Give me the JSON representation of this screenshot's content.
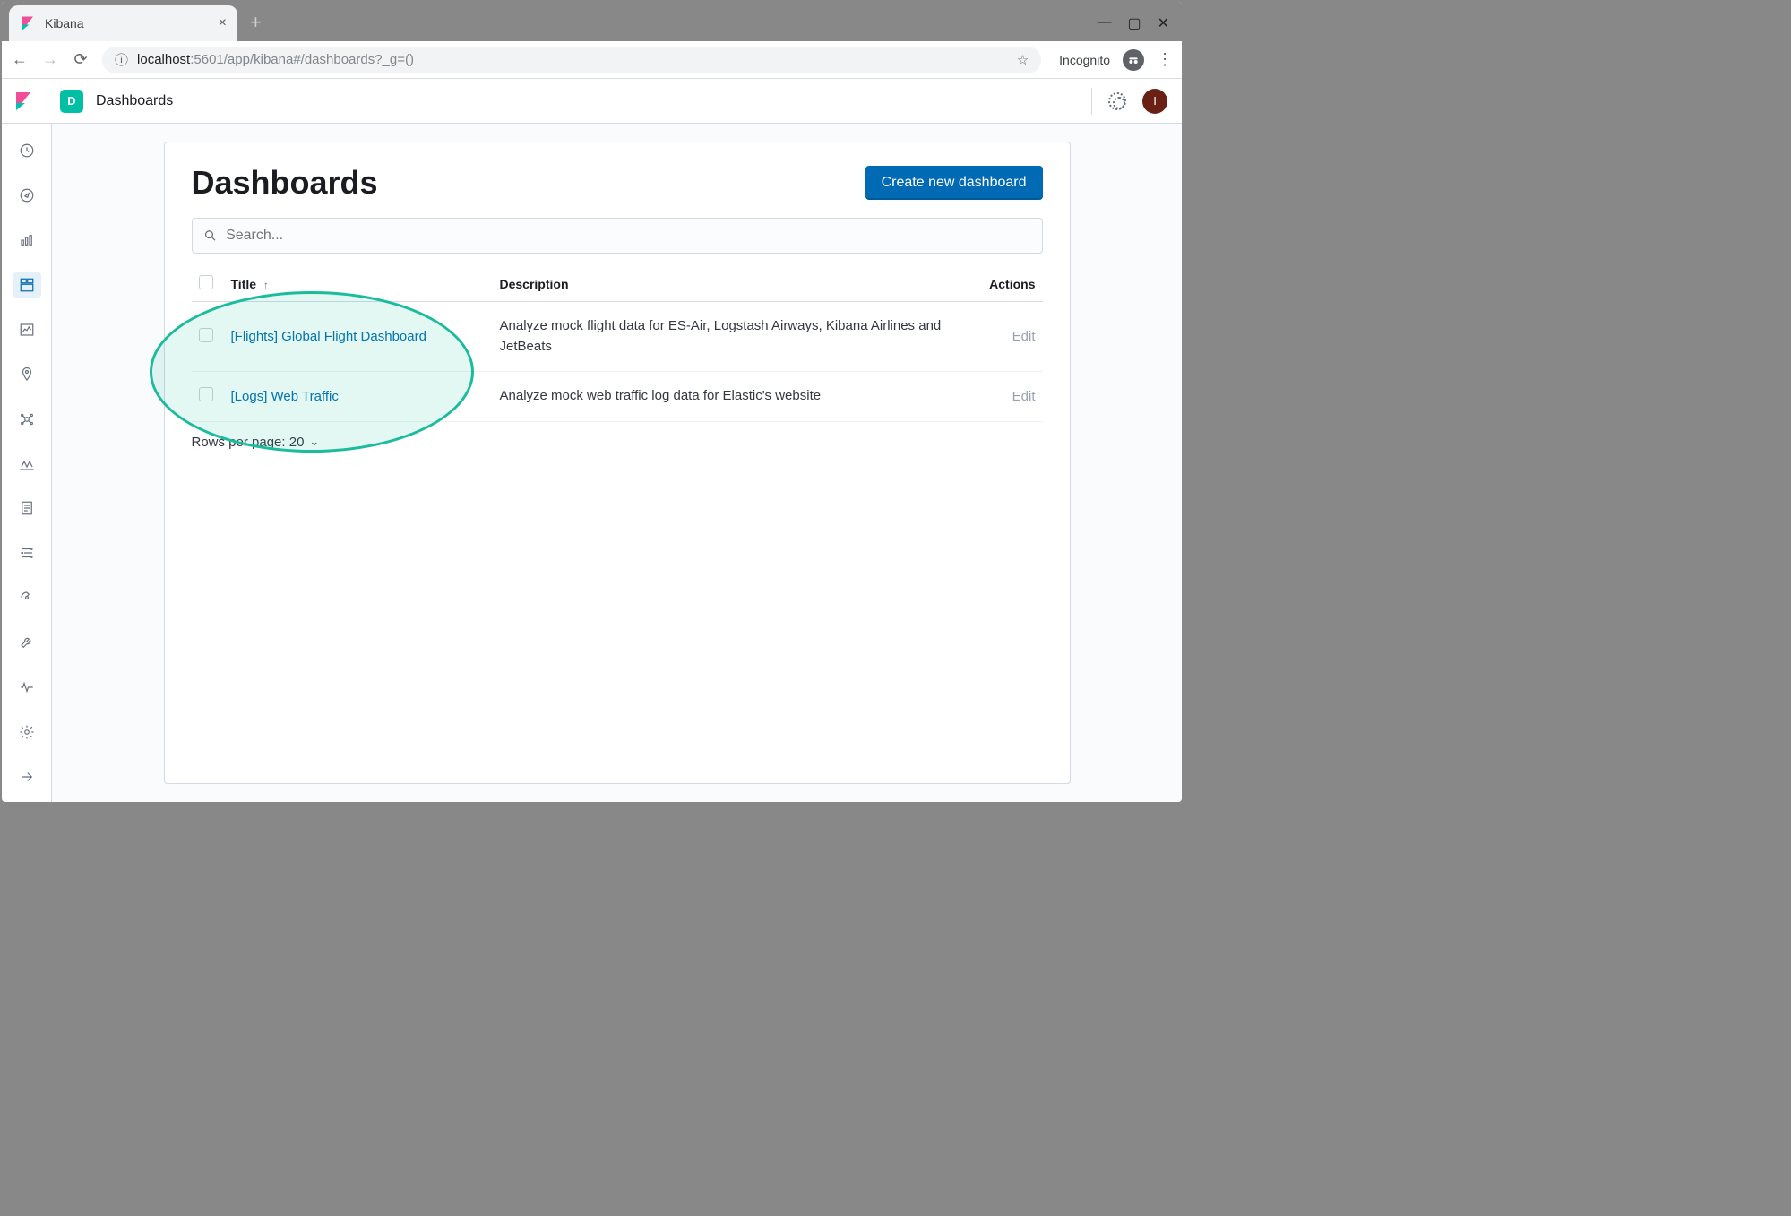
{
  "browser": {
    "tab_title": "Kibana",
    "url_host": "localhost",
    "url_path": ":5601/app/kibana#/dashboards?_g=()",
    "incognito_label": "Incognito"
  },
  "header": {
    "app_badge": "D",
    "breadcrumb": "Dashboards",
    "avatar_initial": "I"
  },
  "page": {
    "title": "Dashboards",
    "create_btn": "Create new dashboard",
    "search_placeholder": "Search...",
    "columns": {
      "title": "Title",
      "description": "Description",
      "actions": "Actions"
    },
    "rows": [
      {
        "title": "[Flights] Global Flight Dashboard",
        "description": "Analyze mock flight data for ES-Air, Logstash Airways, Kibana Airlines and JetBeats",
        "action": "Edit"
      },
      {
        "title": "[Logs] Web Traffic",
        "description": "Analyze mock web traffic log data for Elastic's website",
        "action": "Edit"
      }
    ],
    "rows_per_page_label": "Rows per page: 20"
  }
}
